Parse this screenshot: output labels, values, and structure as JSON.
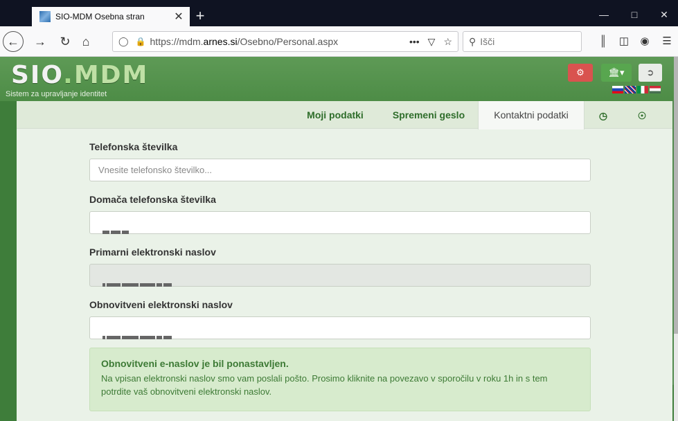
{
  "browser": {
    "tab_title": "SIO-MDM Osebna stran",
    "tab_close": "✕",
    "new_tab": "+",
    "url_prefix": "https://mdm.",
    "url_domain": "arnes.si",
    "url_path": "/Osebno/Personal.aspx",
    "search_placeholder": "Išči",
    "more_actions": "•••"
  },
  "header": {
    "logo_sio": "SIO",
    "logo_dot": ".",
    "logo_mdm": "MDM",
    "tagline": "Sistem za upravljanje identitet"
  },
  "menu": {
    "items": [
      {
        "label": "Moji podatki"
      },
      {
        "label": "Spremeni geslo"
      },
      {
        "label": "Kontaktni podatki"
      }
    ]
  },
  "form": {
    "phone_label": "Telefonska številka",
    "phone_placeholder": "Vnesite telefonsko številko...",
    "home_phone_label": "Domača telefonska številka",
    "primary_email_label": "Primarni elektronski naslov",
    "recovery_email_label": "Obnovitveni elektronski naslov"
  },
  "alert": {
    "title": "Obnovitveni e-naslov je bil ponastavljen.",
    "text": "Na vpisan elektronski naslov smo vam poslali pošto. Prosimo kliknite na povezavo v sporočilu v roku 1h in s tem potrdite vaš obnovitveni elektronski naslov."
  },
  "colors": {
    "brand_green": "#4d8c46",
    "menu_text": "#2e6d2a",
    "alert_bg": "#d7ebcd",
    "danger": "#d9534f"
  }
}
